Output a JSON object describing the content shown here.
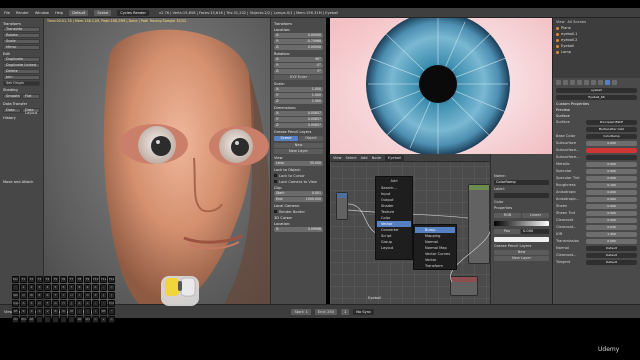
{
  "app": {
    "menu": [
      "File",
      "Render",
      "Window",
      "Help"
    ],
    "screen_layout": "Default",
    "scene": "Scene",
    "engine": "Cycles Render",
    "stats": "v2.76 | Verts:15,658 | Faces:15,616 | Tris:31,232 | Objects:2/2 | Lamps:0/1 | Mem:156.31M | Eyeball"
  },
  "tool_panel": {
    "transform_header": "Transform",
    "transform_buttons": [
      "Translate",
      "Rotate",
      "Scale",
      "Mirror"
    ],
    "edit_header": "Edit",
    "edit_buttons": [
      "Duplicate",
      "Duplicate Linked",
      "Delete",
      "Join"
    ],
    "origin_label": "Set Origin",
    "shading_header": "Shading",
    "shading_buttons": [
      "Smooth",
      "Flat"
    ],
    "data_transfer_header": "Data Transfer",
    "data_transfer_buttons": [
      "Data",
      "Data Layout"
    ],
    "history_header": "History",
    "last_op_header": "Move and Attach"
  },
  "viewport": {
    "header": "Time:00:01.78 | Mem:158.11M, Peak:168.29M | Done | Path Tracing Sample 32/32",
    "object_label": "(1) Eyeball"
  },
  "sidebar_n": {
    "transform_header": "Transform",
    "location_header": "Location:",
    "location": [
      {
        "axis": "X:",
        "value": "0.00000"
      },
      {
        "axis": "Y:",
        "value": "-0.74968"
      },
      {
        "axis": "Z:",
        "value": "0.00000"
      }
    ],
    "rotation_header": "Rotation:",
    "rotation": [
      {
        "axis": "X:",
        "value": "90°"
      },
      {
        "axis": "Y:",
        "value": "-0°"
      },
      {
        "axis": "Z:",
        "value": "0°"
      }
    ],
    "rotation_mode": "XYZ Euler",
    "scale_header": "Scale:",
    "scale": [
      {
        "axis": "X:",
        "value": "1.000"
      },
      {
        "axis": "Y:",
        "value": "1.000"
      },
      {
        "axis": "Z:",
        "value": "1.000"
      }
    ],
    "dimensions_header": "Dimensions:",
    "dimensions": [
      {
        "axis": "X:",
        "value": "0.05857"
      },
      {
        "axis": "Y:",
        "value": "0.05857"
      },
      {
        "axis": "Z:",
        "value": "0.05857"
      }
    ],
    "grease_pencil_header": "Grease Pencil Layers",
    "gp_tabs": [
      "Scene",
      "Object"
    ],
    "new_button": "New",
    "new_layer_button": "New Layer",
    "view_header": "View",
    "lens_label": "Lens:",
    "lens_value": "35.000",
    "lock_label": "Lock to Object:",
    "lock_cursor": "Lock to Cursor",
    "lock_camera": "Lock Camera to View",
    "clip_header": "Clip:",
    "clip_start_label": "Start:",
    "clip_start": "0.001",
    "clip_end_label": "End:",
    "clip_end": "1000.000",
    "local_camera": "Local Camera:",
    "render_border": "Render Border",
    "cursor_header": "3D Cursor",
    "cursor_location": "Location:",
    "cursor_x": "0.09998"
  },
  "node_editor": {
    "header": [
      "View",
      "Select",
      "Add",
      "Node"
    ],
    "material": "Eyeball",
    "add_menu_title": "Add",
    "add_menu_items": [
      "Search...",
      "Input",
      "Output",
      "Shader",
      "Texture",
      "Color",
      "Vector",
      "Converter",
      "Script",
      "Group",
      "Layout"
    ],
    "vector_submenu": [
      "Bump",
      "Mapping",
      "Normal",
      "Normal Map",
      "Vector Curves",
      "Vector Transform"
    ],
    "footer_label": "Eyeball"
  },
  "node_panel": {
    "name_label": "Name:",
    "name_value": "ColorRamp",
    "label_label": "Label:",
    "color_label": "Color",
    "properties_label": "Properties",
    "rgb_mode": "RGB",
    "interp": "Linear",
    "pos_label": "Pos",
    "pos_value": "0.000",
    "new_button": "New",
    "new_layer_button": "New Layer",
    "gp_header": "Grease Pencil Layers"
  },
  "outliner": {
    "rows": [
      "Plane",
      "eyeball.1",
      "eyeball.2",
      "Eyeball",
      "Lamp"
    ],
    "view_button": "View",
    "search_button": "All Scenes"
  },
  "properties": {
    "material_slot": "eyeball",
    "material_name": "Eyeball_blt",
    "custom_props": "Custom Properties",
    "preview_header": "Preview",
    "surface_header": "Surface",
    "surface_value": "Principled BSDF",
    "rows": [
      {
        "k": "Surface",
        "v": "Principled BSDF",
        "style": "dark"
      },
      {
        "k": "",
        "v": "Multiscatter GGX",
        "style": "dark"
      },
      {
        "k": "Base Color",
        "v": "ColorRamp",
        "style": "dark"
      },
      {
        "k": "Subsurface",
        "v": "0.000",
        "style": ""
      },
      {
        "k": "Subsurface...",
        "v": "",
        "style": "red"
      },
      {
        "k": "Subsurface...",
        "v": "",
        "style": "dark"
      },
      {
        "k": "Metallic",
        "v": "0.000",
        "style": ""
      },
      {
        "k": "Specular",
        "v": "0.500",
        "style": ""
      },
      {
        "k": "Specular Tint",
        "v": "0.000",
        "style": ""
      },
      {
        "k": "Roughness",
        "v": "0.100",
        "style": ""
      },
      {
        "k": "Anisotropic",
        "v": "0.000",
        "style": ""
      },
      {
        "k": "Anisotropic...",
        "v": "0.000",
        "style": ""
      },
      {
        "k": "Sheen",
        "v": "0.000",
        "style": ""
      },
      {
        "k": "Sheen Tint",
        "v": "0.500",
        "style": ""
      },
      {
        "k": "Clearcoat",
        "v": "0.000",
        "style": ""
      },
      {
        "k": "Clearcoat...",
        "v": "0.030",
        "style": ""
      },
      {
        "k": "IOR",
        "v": "1.450",
        "style": ""
      },
      {
        "k": "Transmission",
        "v": "0.000",
        "style": ""
      },
      {
        "k": "Normal",
        "v": "Default",
        "style": "dark"
      },
      {
        "k": "Clearcoat...",
        "v": "Default",
        "style": "dark"
      },
      {
        "k": "Tangent",
        "v": "Default",
        "style": "dark"
      }
    ]
  },
  "timeline": {
    "items": [
      "View",
      "Select",
      "Object",
      "Object Mode",
      "Global"
    ],
    "start_label": "Start:",
    "start": "1",
    "end_label": "End:",
    "end": "250",
    "frame": "1",
    "sync": "No Sync"
  },
  "keyboard": {
    "rows": [
      [
        "Esc",
        "F1",
        "F2",
        "F3",
        "F4",
        "F5",
        "F6",
        "F7",
        "F8",
        "F9",
        "F10",
        "F11",
        "F12"
      ],
      [
        "`",
        "1",
        "2",
        "3",
        "4",
        "5",
        "6",
        "7",
        "8",
        "9",
        "0",
        "-",
        "="
      ],
      [
        "Tab",
        "Q",
        "W",
        "E",
        "R",
        "T",
        "Y",
        "U",
        "I",
        "O",
        "P",
        "[",
        "]"
      ],
      [
        "Cap",
        "A",
        "S",
        "D",
        "F",
        "G",
        "H",
        "J",
        "K",
        "L",
        ";",
        "'",
        "Ent"
      ],
      [
        "Sft",
        "Z",
        "X",
        "C",
        "V",
        "B",
        "N",
        "M",
        ",",
        ".",
        "/",
        "Sft",
        "^"
      ],
      [
        "Ctl",
        "Win",
        "Alt",
        "",
        "",
        "",
        "",
        "",
        "Alt",
        "Ctl",
        "<",
        "v",
        ">"
      ]
    ]
  },
  "watermark": "Udemy"
}
